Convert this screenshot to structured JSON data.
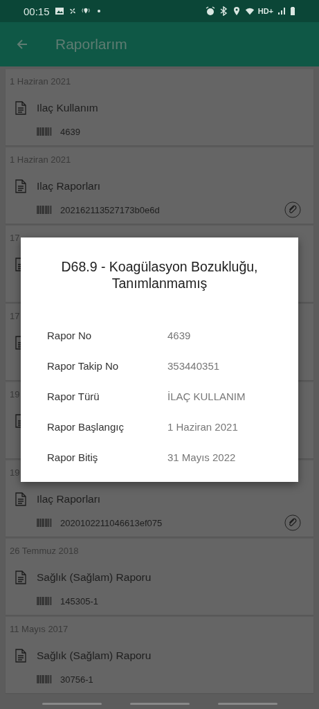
{
  "status_bar": {
    "time": "00:15",
    "network": "HD+"
  },
  "header": {
    "title": "Raporlarım"
  },
  "reports": [
    {
      "date": "1 Haziran 2021",
      "title": "Ilaç Kullanım",
      "number": "4639",
      "attachment": false
    },
    {
      "date": "1 Haziran 2021",
      "title": "Ilaç Raporları",
      "number": "202162113527173b0e6d",
      "attachment": true
    },
    {
      "date": "17"
    },
    {
      "date": "17"
    },
    {
      "date": "19"
    },
    {
      "date": "19",
      "title": "Ilaç Raporları",
      "number": "2020102211046613ef075",
      "attachment": true
    },
    {
      "date": "26 Temmuz 2018",
      "title": "Sağlık (Sağlam) Raporu",
      "number": "145305-1",
      "attachment": false
    },
    {
      "date": "11 Mayıs 2017",
      "title": "Sağlık (Sağlam) Raporu",
      "number": "30756-1",
      "attachment": false
    }
  ],
  "dialog": {
    "title": "D68.9 - Koagülasyon Bozukluğu, Tanımlanmamış",
    "fields": [
      {
        "label": "Rapor No",
        "value": "4639"
      },
      {
        "label": "Rapor Takip No",
        "value": "353440351"
      },
      {
        "label": "Rapor Türü",
        "value": "İLAÇ KULLANIM"
      },
      {
        "label": "Rapor Başlangıç",
        "value": "1 Haziran 2021"
      },
      {
        "label": "Rapor Bitiş",
        "value": "31 Mayıs 2022"
      }
    ]
  }
}
